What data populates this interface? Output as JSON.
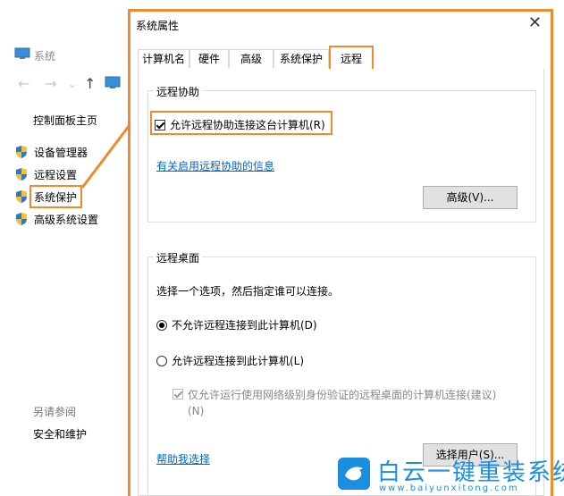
{
  "background_window": {
    "title": "系统",
    "sidebar_home": "控制面板主页",
    "sidebar_items": [
      "设备管理器",
      "远程设置",
      "系统保护",
      "高级系统设置"
    ],
    "see_also": "另请参阅",
    "security": "安全和维护"
  },
  "dialog": {
    "title": "系统属性",
    "close": "✕",
    "tabs": [
      "计算机名",
      "硬件",
      "高级",
      "系统保护",
      "远程"
    ],
    "active_tab": "远程",
    "remote_assist": {
      "group_label": "远程协助",
      "allow_checkbox": "允许远程协助连接这台计算机(R)",
      "allow_checked": true,
      "info_link": "有关启用远程协助的信息",
      "advanced_button": "高级(V)..."
    },
    "remote_desktop": {
      "group_label": "远程桌面",
      "prompt": "选择一个选项，然后指定谁可以连接。",
      "option_deny": "不允许远程连接到此计算机(D)",
      "option_allow": "允许远程连接到此计算机(L)",
      "selected": "deny",
      "nla_checkbox_line1": "仅允许运行使用网络级别身份验证的远程桌面的计算机连接(建议)",
      "nla_checkbox_line2": "(N)",
      "help_link": "帮助我选择",
      "select_users_button": "选择用户(S)..."
    }
  },
  "watermark": {
    "cn": "白云一键重装系统",
    "en": "www.baiyunxitong.com"
  },
  "colors": {
    "highlight": "#ee8a30",
    "link": "#0066cc",
    "watermark": "#1b8ee0"
  }
}
